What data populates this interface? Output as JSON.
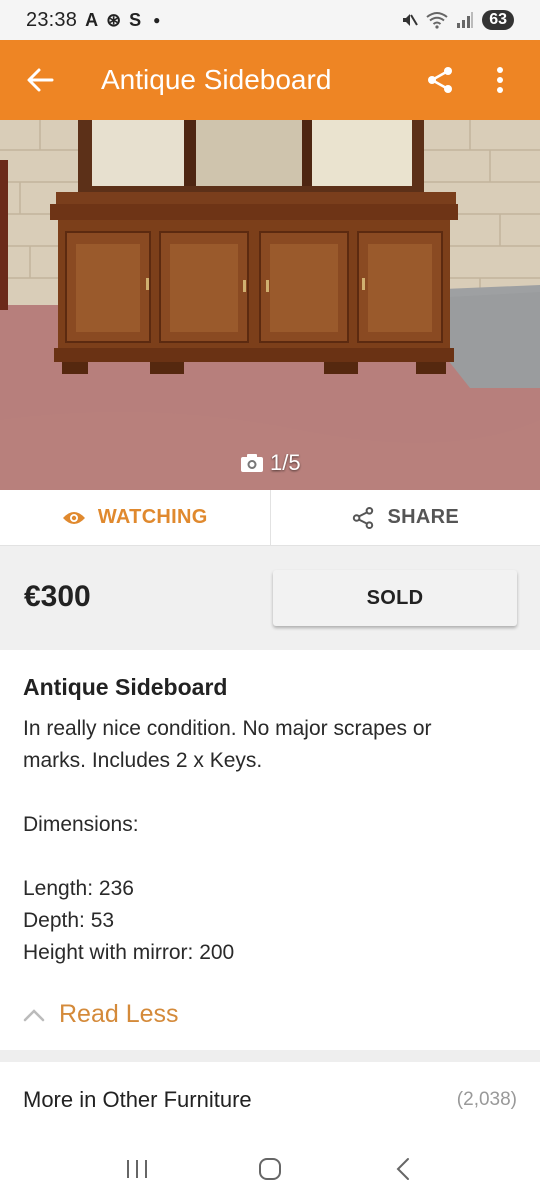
{
  "status_bar": {
    "time": "23:38",
    "notif_icons": [
      "A",
      "⊛",
      "S"
    ],
    "battery": "63"
  },
  "app_bar": {
    "title": "Antique Sideboard",
    "icons": [
      "back-arrow-icon",
      "share-icon",
      "more-vert-icon"
    ]
  },
  "gallery": {
    "counter": "1/5"
  },
  "actions": {
    "watch_label": "WATCHING",
    "share_label": "SHARE"
  },
  "listing": {
    "price": "€300",
    "status_label": "SOLD",
    "title": "Antique Sideboard",
    "description_lines": [
      "In really nice condition. No major scrapes or",
      "marks. Includes 2 x Keys.",
      "",
      "Dimensions:",
      "",
      "Length: 236",
      "Depth: 53",
      "Height with mirror: 200"
    ],
    "read_less": "Read Less"
  },
  "more_section": {
    "label": "More in Other Furniture",
    "count": "(2,038)"
  },
  "colors": {
    "brand_orange": "#ee8524",
    "watch_orange": "#e0892e",
    "read_less_orange": "#d48a3a"
  }
}
